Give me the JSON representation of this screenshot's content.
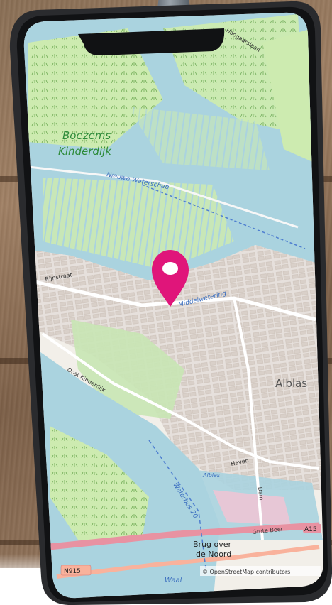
{
  "map": {
    "places": {
      "boezems_line1": "Boezems",
      "boezems_line2": "Kinderdijk",
      "alblas_city": "Alblas",
      "alblas_small": "Alblas"
    },
    "roads": {
      "hoogaarslaan": "Hoogaarslaan",
      "nieuwe_waterschap": "Nieuwe Waterschap",
      "rijnstraat": "Rijnstraat",
      "middelwetering": "Middelwetering",
      "oost_kinderdijk": "Oost Kinderdijk",
      "haven": "Haven",
      "dam": "Dam",
      "waterbus": "Waterbus 20",
      "grote_beer": "Grote Beer",
      "a15": "A15",
      "n915": "N915",
      "waal": "Waal"
    },
    "pois": {
      "brug_line1": "Brug over",
      "brug_line2": "de Noord"
    },
    "attribution": "© OpenStreetMap contributors"
  },
  "colors": {
    "water": "#aad3df",
    "land": "#f2efe9",
    "polder": "#cdebb0",
    "marker": "#e0157a",
    "motorway": "#e892a2",
    "trunk": "#f9b29c"
  }
}
